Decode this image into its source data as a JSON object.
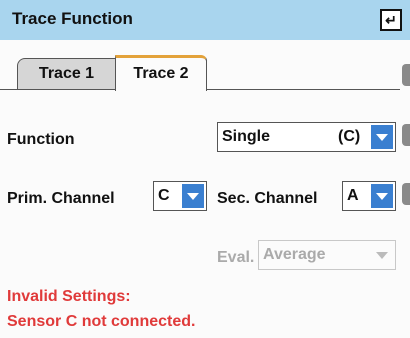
{
  "titlebar": {
    "title": "Trace Function",
    "enter_icon": "↵"
  },
  "tabs": [
    {
      "label": "Trace 1",
      "active": false
    },
    {
      "label": "Trace 2",
      "active": true
    }
  ],
  "function": {
    "label": "Function",
    "value": "Single",
    "suffix": "(C)"
  },
  "prim_channel": {
    "label": "Prim. Channel",
    "value": "C"
  },
  "sec_channel": {
    "label": "Sec. Channel",
    "value": "A"
  },
  "eval": {
    "label": "Eval.",
    "value": "Average",
    "enabled": false
  },
  "error": {
    "line1": "Invalid Settings:",
    "line2": "Sensor C not connected."
  },
  "colors": {
    "titlebar": "#a9d5ee",
    "accent": "#3a7fd0",
    "error": "#e03a3a",
    "tab_highlight": "#e3a23a"
  }
}
